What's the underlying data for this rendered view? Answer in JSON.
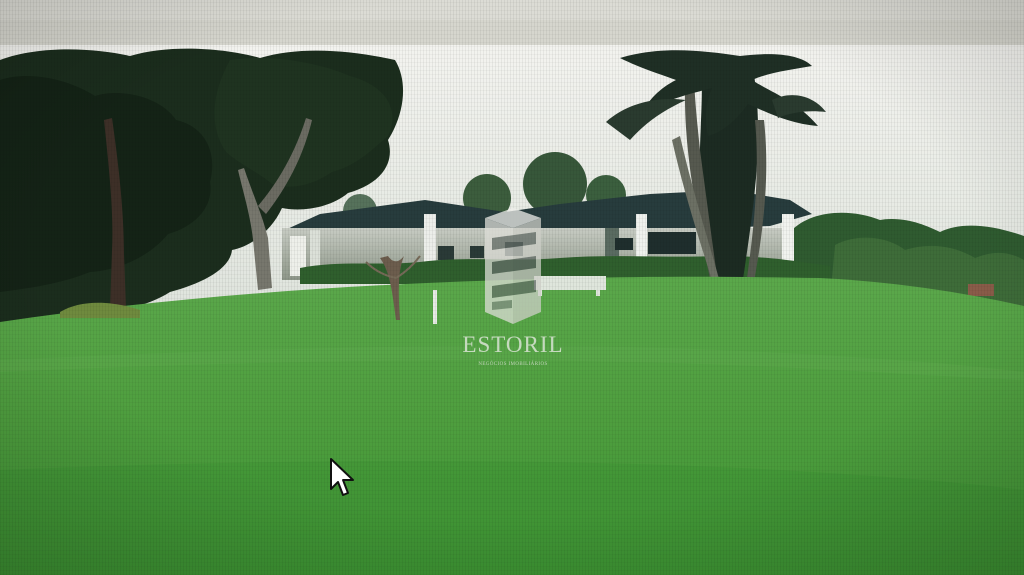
{
  "scene": {
    "description_type": "photograph of a computer monitor showing a country house on a large lawn",
    "sky_color": "#e8ebe5",
    "lawn_color": "#4ea23e",
    "tree_color": "#223322"
  },
  "watermark": {
    "name": "ESTORIL",
    "tagline": "NEGÓCIOS IMOBILIÁRIOS",
    "icon": "building-logo-icon"
  },
  "cursor": {
    "icon": "mouse-pointer-icon"
  }
}
